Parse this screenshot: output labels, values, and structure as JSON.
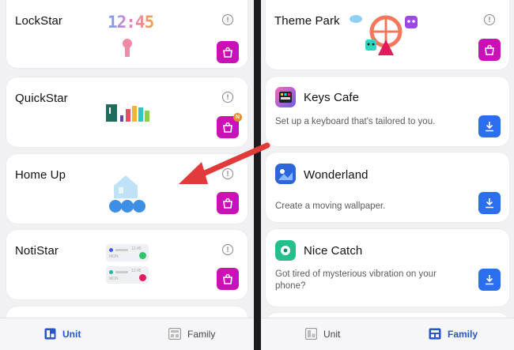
{
  "left_panel": {
    "cards": [
      {
        "title": "LockStar",
        "clock_text": "12:45"
      },
      {
        "title": "QuickStar",
        "badge": "N"
      },
      {
        "title": "Home Up"
      },
      {
        "title": "NotiStar",
        "noti_time": "12:45",
        "noti_sub": "MON"
      }
    ],
    "nav": {
      "unit": "Unit",
      "family": "Family",
      "active": "unit"
    }
  },
  "right_panel": {
    "top_card": {
      "title": "Theme Park"
    },
    "apps": [
      {
        "title": "Keys Cafe",
        "desc": "Set up a keyboard that's tailored to you."
      },
      {
        "title": "Wonderland",
        "desc": "Create a moving wallpaper."
      },
      {
        "title": "Nice Catch",
        "desc": "Got tired of mysterious vibration on your phone?"
      }
    ],
    "nav": {
      "unit": "Unit",
      "family": "Family",
      "active": "family"
    }
  },
  "colors": {
    "store_button": "#c912b5",
    "download_button": "#2b6ef0",
    "arrow": "#e23a3a",
    "nav_active": "#2a55c6"
  }
}
